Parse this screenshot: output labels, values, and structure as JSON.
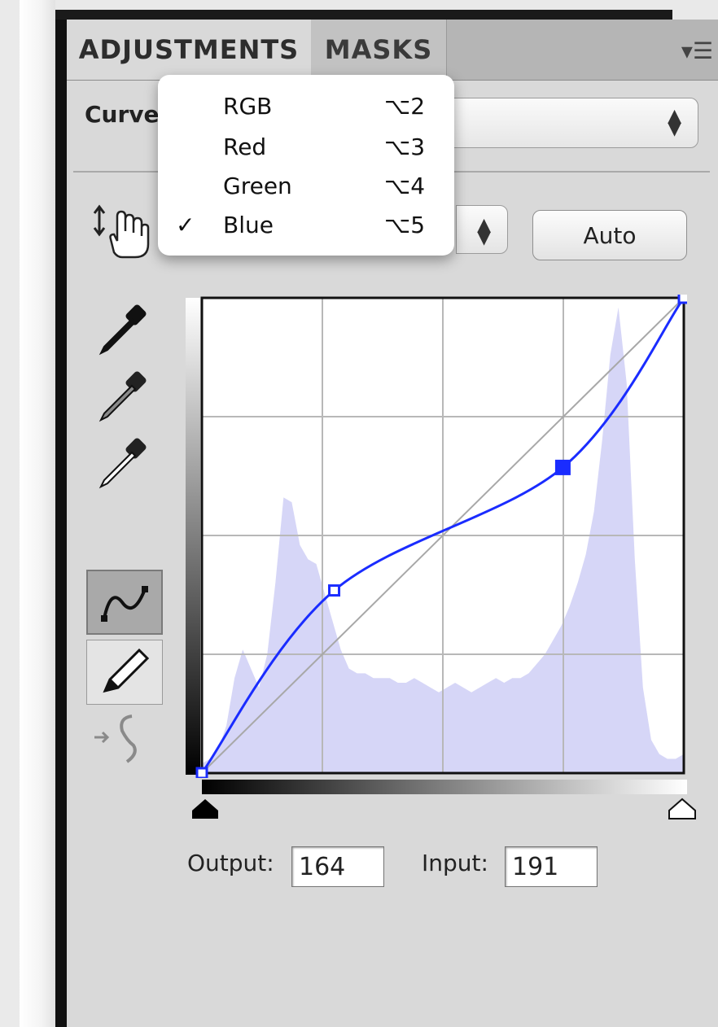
{
  "tabs": [
    {
      "label": "ADJUSTMENTS",
      "active": true
    },
    {
      "label": "MASKS",
      "active": false
    }
  ],
  "panel_menu_icon": "panel-menu-icon",
  "adjustment": {
    "label": "Curves"
  },
  "channel_menu": {
    "items": [
      {
        "label": "RGB",
        "shortcut": "⌥2",
        "checked": false
      },
      {
        "label": "Red",
        "shortcut": "⌥3",
        "checked": false
      },
      {
        "label": "Green",
        "shortcut": "⌥4",
        "checked": false
      },
      {
        "label": "Blue",
        "shortcut": "⌥5",
        "checked": true
      }
    ],
    "check_glyph": "✓"
  },
  "auto_button": {
    "label": "Auto"
  },
  "curve": {
    "channel_color": "#1a2cff",
    "histogram_color": "#d6d6f7",
    "points": [
      {
        "input": 0,
        "output": 0,
        "selected": false
      },
      {
        "input": 70,
        "output": 98,
        "selected": false
      },
      {
        "input": 191,
        "output": 164,
        "selected": true
      },
      {
        "input": 255,
        "output": 255,
        "selected": false
      }
    ]
  },
  "fields": {
    "output_label": "Output:",
    "output_value": "164",
    "input_label": "Input:",
    "input_value": "191"
  }
}
